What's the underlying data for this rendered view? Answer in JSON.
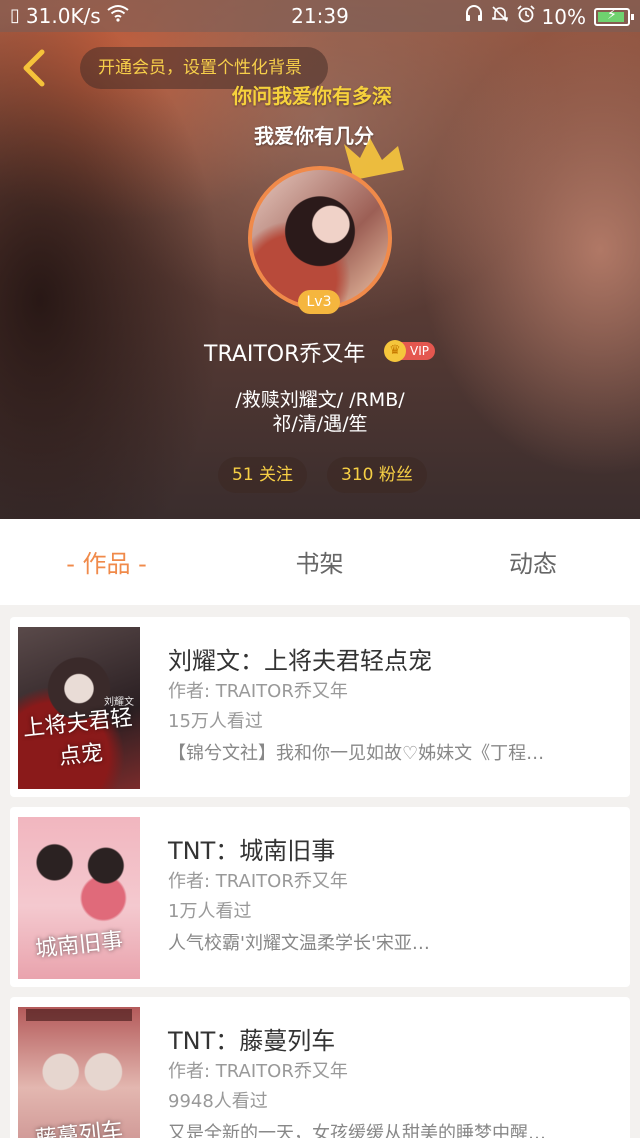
{
  "status_bar": {
    "speed": "31.0K/s",
    "time": "21:39",
    "battery": "10%",
    "icons": [
      "sim-icon",
      "wifi-icon",
      "headset-icon",
      "mute-icon",
      "alarm-icon",
      "battery-icon"
    ]
  },
  "header": {
    "vip_prompt": "开通会员，设置个性化背景",
    "lyric_line1": "你问我爱你有多深",
    "lyric_line2": "我爱你有几分",
    "level": "Lv3",
    "username": "TRAITOR乔又年",
    "vip_label": "VIP",
    "bio_line1": "/救赎刘耀文/ /RMB/",
    "bio_line2": "祁/清/遇/笙",
    "following": "51 关注",
    "followers": "310 粉丝"
  },
  "tabs": [
    {
      "label": "- 作品 -",
      "active": true
    },
    {
      "label": "书架",
      "active": false
    },
    {
      "label": "动态",
      "active": false
    }
  ],
  "books": [
    {
      "title": "刘耀文：上将夫君轻点宠",
      "author": "作者: TRAITOR乔又年",
      "views": "15万人看过",
      "desc": "【锦兮文社】我和你一见如故♡姊妹文《丁程…",
      "cover_text": "上将夫君轻点宠",
      "cover_author": "刘耀文"
    },
    {
      "title": "TNT：城南旧事",
      "author": "作者: TRAITOR乔又年",
      "views": "1万人看过",
      "desc": "人气校霸'刘耀文温柔学长'宋亚…",
      "cover_text": "城南旧事",
      "cover_author": ""
    },
    {
      "title": "TNT：藤蔓列车",
      "author": "作者: TRAITOR乔又年",
      "views": "9948人看过",
      "desc": "又是全新的一天，女孩缓缓从甜美的睡梦中醒…",
      "cover_text": "藤蔓列车",
      "cover_author": ""
    }
  ],
  "colors": {
    "accent": "#f08a4a",
    "gold": "#f6cf45",
    "vip_red": "#e4574f"
  }
}
